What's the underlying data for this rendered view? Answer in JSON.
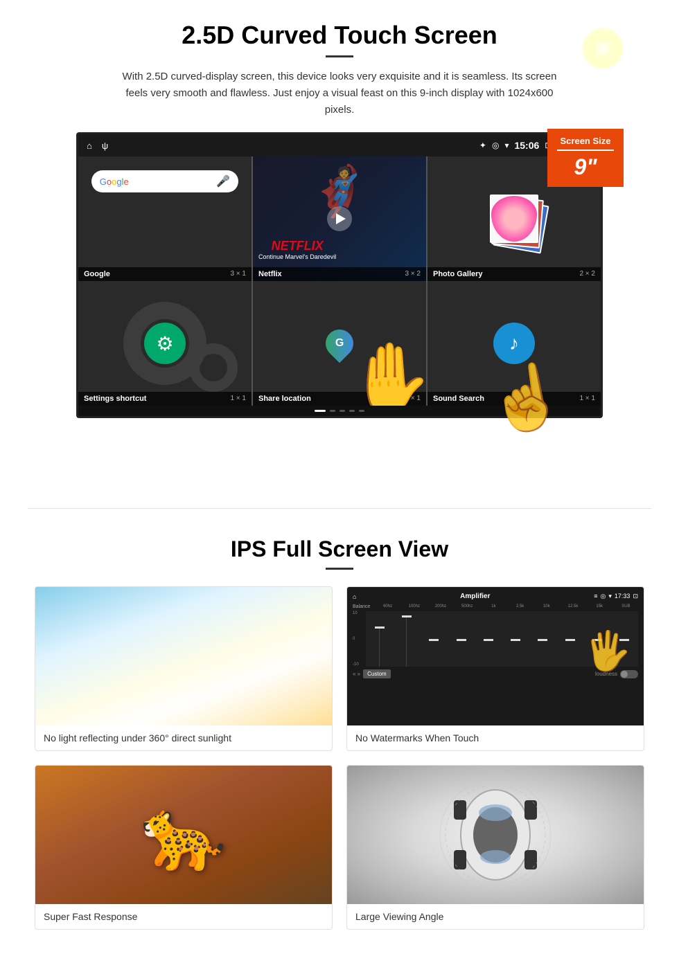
{
  "section1": {
    "title": "2.5D Curved Touch Screen",
    "description": "With 2.5D curved-display screen, this device looks very exquisite and it is seamless. Its screen feels very smooth and flawless. Just enjoy a visual feast on this 9-inch display with 1024x600 pixels.",
    "screen_badge": {
      "label": "Screen Size",
      "size": "9\""
    },
    "status_bar": {
      "time": "15:06"
    },
    "apps": [
      {
        "name": "Google",
        "size": "3 × 1"
      },
      {
        "name": "Netflix",
        "size": "3 × 2",
        "subtitle": "Continue Marvel's Daredevil"
      },
      {
        "name": "Photo Gallery",
        "size": "2 × 2"
      },
      {
        "name": "Settings shortcut",
        "size": "1 × 1"
      },
      {
        "name": "Share location",
        "size": "1 × 1"
      },
      {
        "name": "Sound Search",
        "size": "1 × 1"
      }
    ]
  },
  "section2": {
    "title": "IPS Full Screen View",
    "features": [
      {
        "id": "sunlight",
        "caption": "No light reflecting under 360° direct sunlight"
      },
      {
        "id": "amplifier",
        "caption": "No Watermarks When Touch"
      },
      {
        "id": "cheetah",
        "caption": "Super Fast Response"
      },
      {
        "id": "car",
        "caption": "Large Viewing Angle"
      }
    ]
  }
}
